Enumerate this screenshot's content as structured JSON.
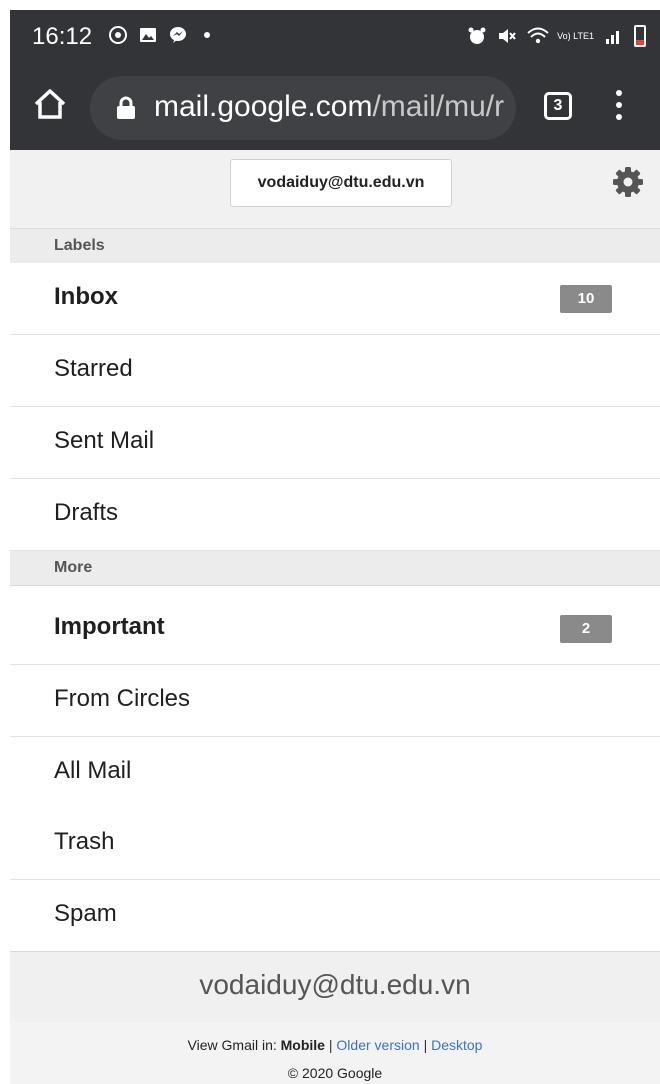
{
  "status_bar": {
    "time": "16:12",
    "lte_label": "Vo) LTE1"
  },
  "browser": {
    "url_host": "mail.google.com",
    "url_path": "/mail/mu/r",
    "tab_count": "3"
  },
  "account": {
    "email": "vodaiduy@dtu.edu.vn"
  },
  "sections": {
    "labels": "Labels",
    "more": "More"
  },
  "labels": [
    {
      "label": "Inbox",
      "badge": "10"
    },
    {
      "label": "Starred"
    },
    {
      "label": "Sent Mail"
    },
    {
      "label": "Drafts"
    }
  ],
  "more": [
    {
      "label": "Important",
      "badge": "2"
    },
    {
      "label": "From Circles"
    },
    {
      "label": "All Mail"
    },
    {
      "label": "Trash"
    },
    {
      "label": "Spam"
    }
  ],
  "footer": {
    "account_email": "vodaiduy@dtu.edu.vn",
    "view_prefix": "View Gmail in:",
    "mobile": "Mobile",
    "separator": "|",
    "older_version": "Older version",
    "desktop": "Desktop",
    "copyright": "© 2020 Google"
  },
  "colors": {
    "chrome_bar": "#323438",
    "badge": "#8a8a8a",
    "link": "#3b73c4"
  }
}
